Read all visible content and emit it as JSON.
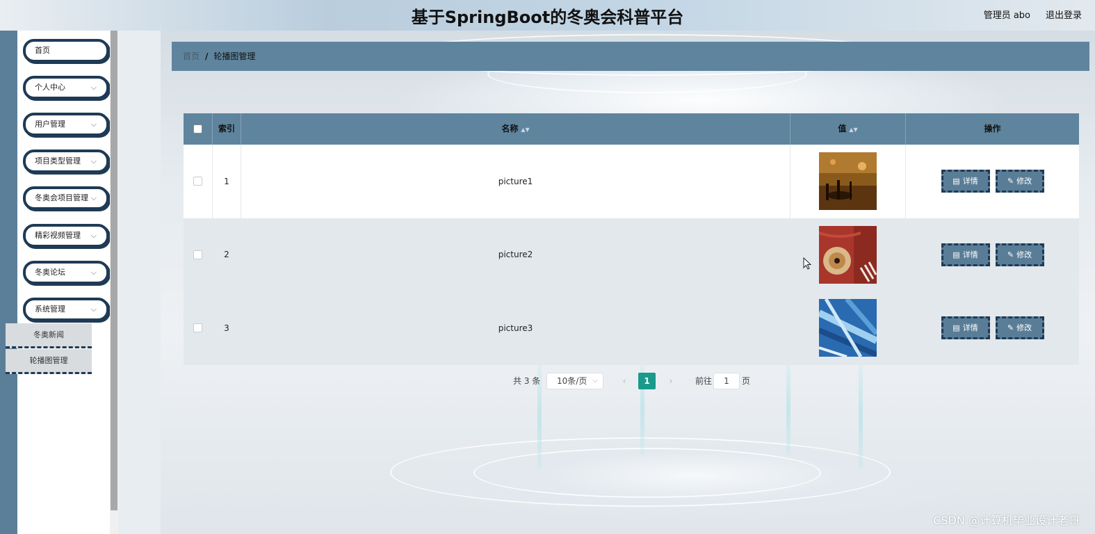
{
  "header": {
    "title": "基于SpringBoot的冬奥会科普平台",
    "user": "管理员 abo",
    "logout": "退出登录"
  },
  "sidebar": {
    "items": [
      {
        "label": "首页",
        "has_chevron": false
      },
      {
        "label": "个人中心",
        "has_chevron": true
      },
      {
        "label": "用户管理",
        "has_chevron": true
      },
      {
        "label": "项目类型管理",
        "has_chevron": true
      },
      {
        "label": "冬奥会项目管理",
        "has_chevron": true
      },
      {
        "label": "精彩视频管理",
        "has_chevron": true
      },
      {
        "label": "冬奥论坛",
        "has_chevron": true
      },
      {
        "label": "系统管理",
        "has_chevron": true
      }
    ],
    "submenu": [
      "冬奥新闻",
      "轮播图管理"
    ]
  },
  "breadcrumb": {
    "home": "首页",
    "separator": "/",
    "current": "轮播图管理"
  },
  "table": {
    "headers": {
      "index": "索引",
      "name": "名称",
      "value": "值",
      "actions": "操作"
    },
    "rows": [
      {
        "index": "1",
        "name": "picture1",
        "thumb": "arena"
      },
      {
        "index": "2",
        "name": "picture2",
        "thumb": "curling"
      },
      {
        "index": "3",
        "name": "picture3",
        "thumb": "skating"
      }
    ],
    "detail_label": "详情",
    "edit_label": "修改"
  },
  "pagination": {
    "total": "共 3 条",
    "page_size": "10条/页",
    "current_page": "1",
    "goto_label": "前往",
    "goto_value": "1",
    "page_suffix": "页"
  },
  "watermark": "CSDN @计算机毕业设计老哥",
  "colors": {
    "accent": "#5f849e",
    "navy": "#1e3a55",
    "pager_active": "#1a9a8a"
  }
}
